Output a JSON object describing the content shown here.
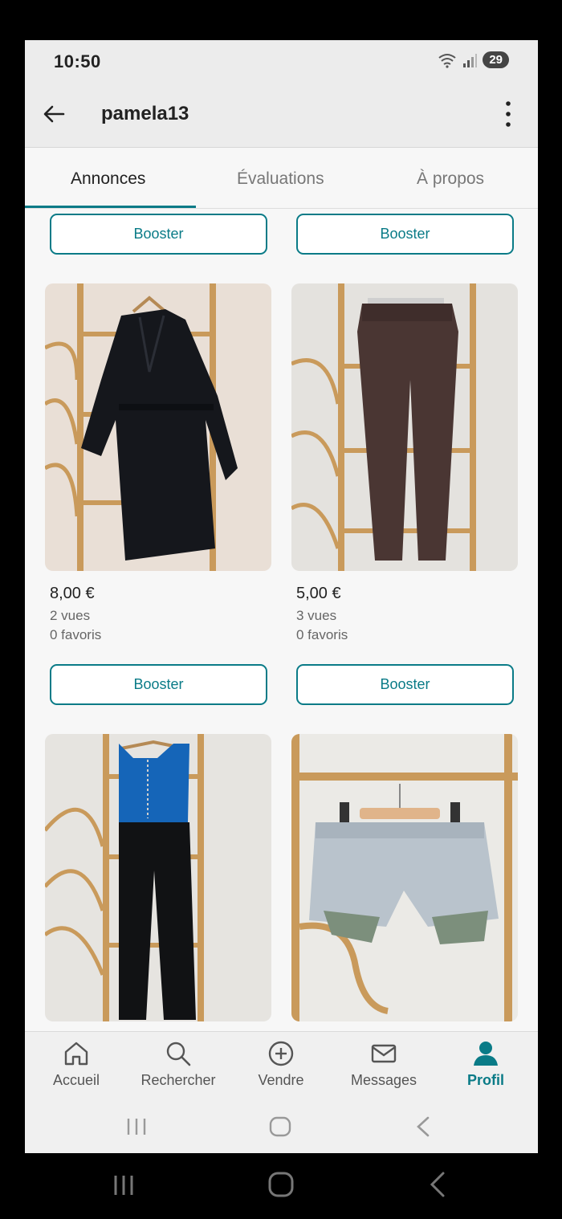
{
  "status": {
    "time": "10:50",
    "battery": "29"
  },
  "header": {
    "title": "pamela13"
  },
  "tabs": [
    {
      "label": "Annonces"
    },
    {
      "label": "Évaluations"
    },
    {
      "label": "À propos"
    }
  ],
  "listings": {
    "booster_label": "Booster",
    "items": [
      {
        "price": "8,00 €",
        "views": "2 vues",
        "favorites": "0 favoris"
      },
      {
        "price": "5,00 €",
        "views": "3 vues",
        "favorites": "0 favoris"
      }
    ]
  },
  "nav": [
    {
      "label": "Accueil",
      "icon": "home-icon"
    },
    {
      "label": "Rechercher",
      "icon": "search-icon"
    },
    {
      "label": "Vendre",
      "icon": "plus-circle-icon"
    },
    {
      "label": "Messages",
      "icon": "mail-icon"
    },
    {
      "label": "Profil",
      "icon": "profile-icon"
    }
  ],
  "colors": {
    "accent": "#0a7b87"
  }
}
